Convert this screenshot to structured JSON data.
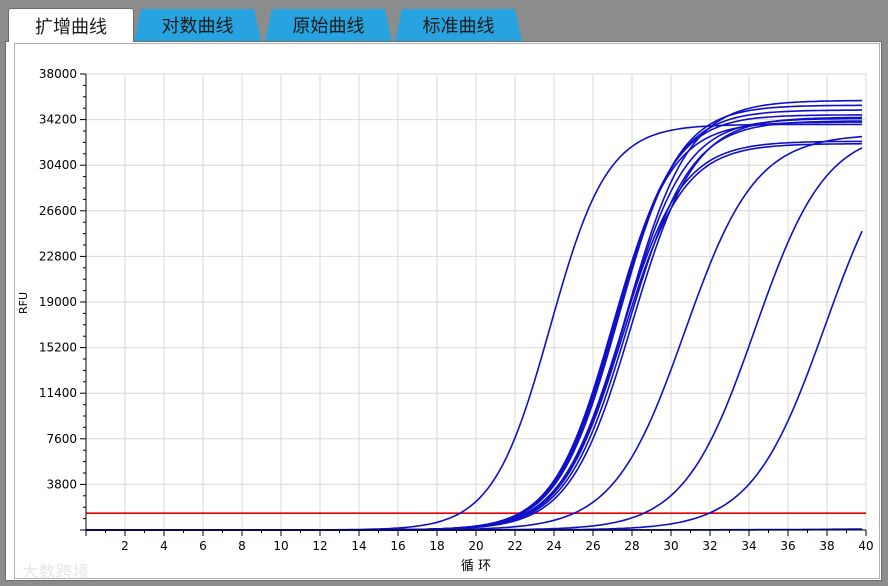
{
  "tabs": [
    {
      "label": "扩增曲线",
      "active": true
    },
    {
      "label": "对数曲线",
      "active": false
    },
    {
      "label": "原始曲线",
      "active": false
    },
    {
      "label": "标准曲线",
      "active": false
    }
  ],
  "watermark": "大数跨境",
  "colors": {
    "curve": "#1010c8",
    "threshold": "#e00000",
    "tab_active": "#ffffff",
    "tab_inactive": "#27a3df"
  },
  "chart_data": {
    "type": "line",
    "title": "",
    "xlabel": "循 环",
    "ylabel": "RFU",
    "xlim": [
      0,
      40
    ],
    "ylim": [
      0,
      38000
    ],
    "x_ticks": [
      2,
      4,
      6,
      8,
      10,
      12,
      14,
      16,
      18,
      20,
      22,
      24,
      26,
      28,
      30,
      32,
      34,
      36,
      38,
      40
    ],
    "y_ticks": [
      3800,
      7600,
      11400,
      15200,
      19000,
      22800,
      26600,
      30400,
      34200,
      38000
    ],
    "grid": true,
    "threshold": 1400,
    "series": [
      {
        "midpoint": 23.8,
        "slope": 0.68,
        "plateau": 33800
      },
      {
        "midpoint": 27.0,
        "slope": 0.66,
        "plateau": 34000
      },
      {
        "midpoint": 27.1,
        "slope": 0.66,
        "plateau": 34600
      },
      {
        "midpoint": 27.2,
        "slope": 0.65,
        "plateau": 35000
      },
      {
        "midpoint": 27.3,
        "slope": 0.65,
        "plateau": 35400
      },
      {
        "midpoint": 27.4,
        "slope": 0.64,
        "plateau": 32400
      },
      {
        "midpoint": 27.5,
        "slope": 0.64,
        "plateau": 32200
      },
      {
        "midpoint": 27.6,
        "slope": 0.64,
        "plateau": 34300
      },
      {
        "midpoint": 27.7,
        "slope": 0.63,
        "plateau": 35800
      },
      {
        "midpoint": 27.8,
        "slope": 0.63,
        "plateau": 34100
      },
      {
        "midpoint": 28.0,
        "slope": 0.63,
        "plateau": 34400
      },
      {
        "midpoint": 30.7,
        "slope": 0.55,
        "plateau": 33000
      },
      {
        "midpoint": 34.3,
        "slope": 0.55,
        "plateau": 33400
      },
      {
        "midpoint": 37.9,
        "slope": 0.53,
        "plateau": 34000
      },
      {
        "midpoint": 50.0,
        "slope": 0.2,
        "plateau": 300
      },
      {
        "midpoint": 50.0,
        "slope": 0.2,
        "plateau": 700
      }
    ]
  }
}
